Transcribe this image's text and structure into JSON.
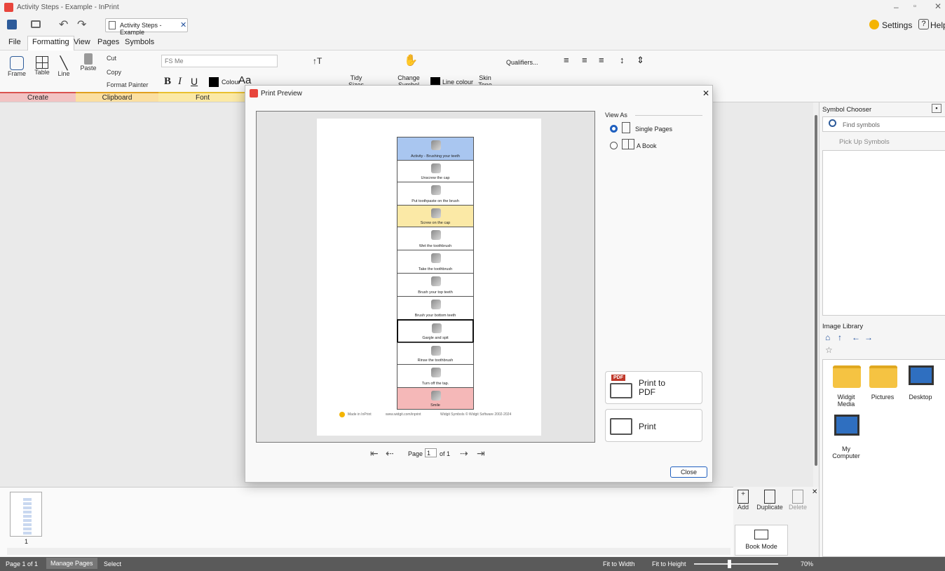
{
  "window": {
    "title": "Activity Steps - Example - InPrint",
    "document_tab": "Activity Steps - Example"
  },
  "topright": {
    "settings": "Settings",
    "help": "Help"
  },
  "menu": [
    "File",
    "Formatting",
    "View",
    "Pages",
    "Symbols"
  ],
  "ribbon": {
    "frame": "Frame",
    "table": "Table",
    "line": "Line",
    "paste": "Paste",
    "cut": "Cut",
    "copy": "Copy",
    "format_painter": "Format Painter",
    "font_name": "FS Me",
    "colour": "Colour",
    "aa": "Aa",
    "tidy_sizes": "Tidy Sizes",
    "change_symbol_text": "Change Symbol Text",
    "line_colour": "Line colour",
    "skin_tone": "Skin Tone",
    "qualifiers": "Qualifiers...",
    "groups": {
      "create": "Create",
      "clipboard": "Clipboard",
      "font": "Font"
    }
  },
  "dialog": {
    "title": "Print Preview",
    "view_as": "View As",
    "single_pages": "Single Pages",
    "a_book": "A Book",
    "print_to_pdf": "Print to PDF",
    "print": "Print",
    "close": "Close",
    "page_label": "Page",
    "page_value": "1",
    "of_label": "of 1",
    "pdf_badge": "PDF"
  },
  "paper": {
    "rows": [
      {
        "text": "Activity  -  Brushing your teeth",
        "bg": "#a9c6f0"
      },
      {
        "text": "Unscrew the cap",
        "bg": "#ffffff"
      },
      {
        "text": "Put toothpaste on the brush",
        "bg": "#ffffff"
      },
      {
        "text": "Screw on the cap",
        "bg": "#fbe9a6"
      },
      {
        "text": "Wet   the toothbrush",
        "bg": "#ffffff"
      },
      {
        "text": "Take  the toothbrush",
        "bg": "#ffffff"
      },
      {
        "text": "Brush your   top   teeth",
        "bg": "#ffffff"
      },
      {
        "text": "Brush your bottom teeth",
        "bg": "#ffffff"
      },
      {
        "text": "Gargle   and   spit",
        "bg": "#ffffff"
      },
      {
        "text": "Rinse  the toothbrush",
        "bg": "#ffffff"
      },
      {
        "text": "Turn off   the   tap.",
        "bg": "#ffffff"
      },
      {
        "text": "Smile",
        "bg": "#f5b8b8"
      }
    ],
    "footer_made": "Made in InPrint",
    "footer_url": "www.widgit.com/inprint",
    "footer_copy": "Widgit Symbols © Widgit Software 2002-2024"
  },
  "right_panel": {
    "symbol_chooser": "Symbol Chooser",
    "find_symbols": "Find symbols",
    "pick_up": "Pick Up Symbols",
    "image_library": "Image Library",
    "folders": [
      "Widgit Media",
      "Pictures",
      "Desktop",
      "My Computer"
    ]
  },
  "page_actions": {
    "add": "Add",
    "duplicate": "Duplicate",
    "delete": "Delete",
    "book_mode": "Book Mode"
  },
  "thumb_page": "1",
  "status": {
    "page": "Page 1 of 1",
    "manage": "Manage Pages",
    "select": "Select",
    "fit_width": "Fit to Width",
    "fit_height": "Fit to Height",
    "zoom": "70%"
  }
}
